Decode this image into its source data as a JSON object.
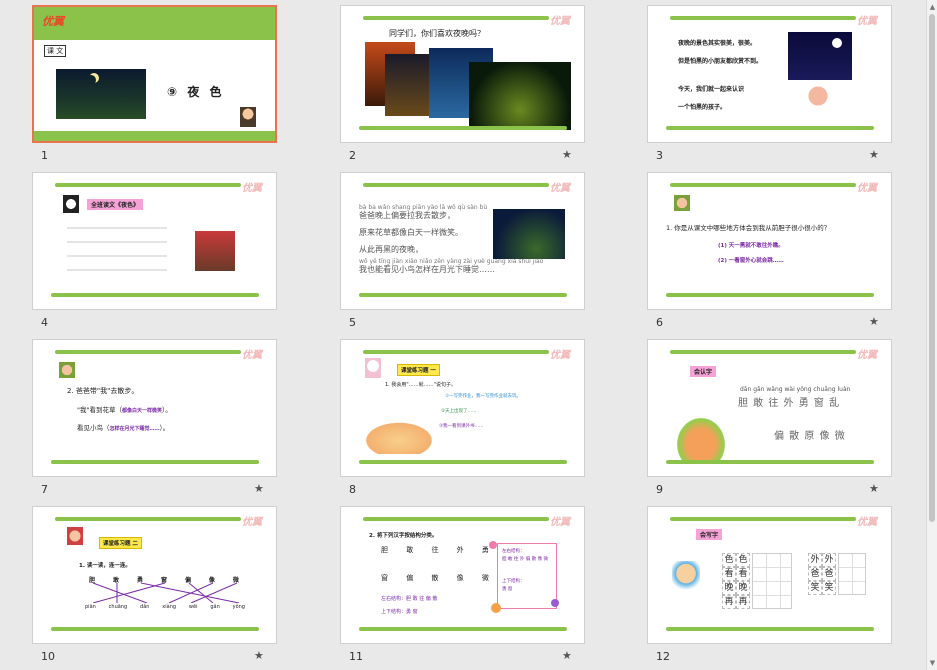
{
  "colors": {
    "accent_green": "#8bc34a",
    "selected_border": "#e8734f",
    "highlight_pink": "#f5a3d6",
    "highlight_yellow": "#ffe94a",
    "answer_purple": "#7a2aa8"
  },
  "slides": [
    {
      "number": "1",
      "lesson_tag": "课 文",
      "title": "⑨ 夜 色",
      "brand": "优翼"
    },
    {
      "number": "2",
      "prompt": "同学们，你们喜欢夜晚吗？",
      "brand": "优翼"
    },
    {
      "number": "3",
      "lines": [
        "夜晚的景色其实很美，很美。",
        "但是怕黑的小朋友都欣赏不到。",
        "今天，我们就一起来认识",
        "一个怕黑的孩子。"
      ],
      "brand": "优翼"
    },
    {
      "number": "4",
      "heading": "全班读文《夜色》",
      "brand": "优翼"
    },
    {
      "number": "5",
      "pinyin1": "bà ba wǎn shang piān yào lā wǒ qù sàn bù",
      "line1": "爸爸晚上偏要拉我去散步，",
      "line2": "原来花草都像白天一样微笑。",
      "line3": "从此再黑的夜晚，",
      "pinyin4": "wǒ yě tīng jiàn xiǎo niǎo zěn yàng zài yuè guāng xià shuì jiào",
      "line4": "我也能看见小鸟怎样在月光下睡觉……",
      "brand": "优翼"
    },
    {
      "number": "6",
      "question": "1. 你是从课文中哪些地方体会到我从前胆子很小很小的？",
      "answer1": "(1) 天一黑就不敢往外瞧。",
      "answer2": "(2) 一看窗外心就会跳……",
      "brand": "优翼"
    },
    {
      "number": "7",
      "item": "2. 爸爸带\"我\"去散步。",
      "line_a_prefix": "\"我\"看到花草（",
      "line_a_answer": "都像白天一样微笑",
      "line_a_suffix": "）。",
      "line_b_prefix": "看见小鸟（",
      "line_b_answer": "怎样在月光下睡觉……",
      "line_b_suffix": "）。",
      "brand": "优翼"
    },
    {
      "number": "8",
      "exercise": "课堂练习题 一",
      "task": "1. 我会用\"……就……\"说句子。",
      "s1": "①一写完作业，我一写完作业就去玩。",
      "s2": "②天上出现了……",
      "s3": "③我一看到课外书……",
      "brand": "优翼"
    },
    {
      "number": "9",
      "tag": "会认字",
      "pinyin": "dǎn gǎn wǎng wài yǒng chuāng luàn",
      "row1": "胆 敢 往 外 勇 窗 乱",
      "row2": "偏 散 原 像 微",
      "brand": "优翼"
    },
    {
      "number": "10",
      "exercise": "课堂练习题 二",
      "task": "1. 读一读，连一连。",
      "chars": [
        "胆",
        "敢",
        "勇",
        "窗",
        "偏",
        "像",
        "微"
      ],
      "pinyin": [
        "piān",
        "chuāng",
        "dǎn",
        "xiàng",
        "wēi",
        "gǎn",
        "yǒng"
      ],
      "brand": "优翼"
    },
    {
      "number": "11",
      "task": "2. 将下列汉字按结构分类。",
      "row1": "胆 敢 往 外 勇",
      "row2": "窗 偏 散 像 微",
      "left_right": "左右结构：胆 敢 往 偏 散",
      "top_bottom": "上下结构：勇 窗",
      "box_l1": "左右结构：",
      "box_l2": "胆 敢 往 外 偏 散 像 微",
      "box_l3": "上下结构：",
      "box_l4": "勇 窗",
      "brand": "优翼"
    },
    {
      "number": "12",
      "tag": "会写字",
      "grid1": [
        "色",
        "色",
        "看",
        "看",
        "晚",
        "晚",
        "再",
        "再"
      ],
      "grid2": [
        "外",
        "外",
        "爸",
        "爸",
        "笑",
        "笑"
      ],
      "brand": "优翼"
    }
  ]
}
